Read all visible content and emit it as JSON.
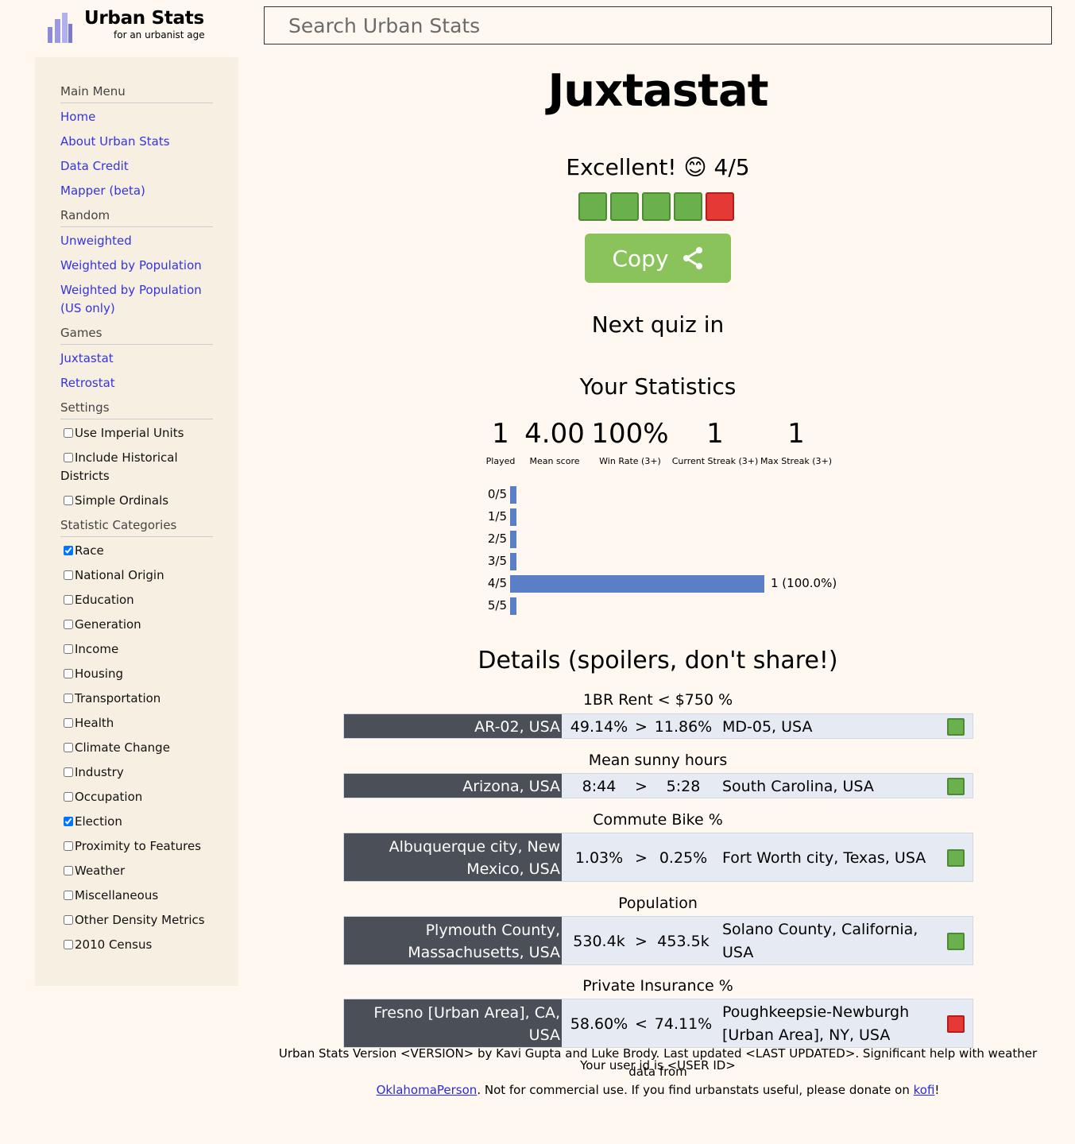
{
  "brand": {
    "title": "Urban Stats",
    "subtitle": "for an urbanist age"
  },
  "search": {
    "placeholder": "Search Urban Stats"
  },
  "sidebar": {
    "main_menu": {
      "heading": "Main Menu",
      "items": [
        "Home",
        "About Urban Stats",
        "Data Credit",
        "Mapper (beta)"
      ]
    },
    "random": {
      "heading": "Random",
      "items": [
        "Unweighted",
        "Weighted by Population",
        "Weighted by Population (US only)"
      ]
    },
    "games": {
      "heading": "Games",
      "items": [
        "Juxtastat",
        "Retrostat"
      ]
    },
    "settings": {
      "heading": "Settings",
      "items": [
        {
          "label": "Use Imperial Units",
          "checked": false
        },
        {
          "label": "Include Historical Districts",
          "checked": false
        },
        {
          "label": "Simple Ordinals",
          "checked": false
        }
      ]
    },
    "categories": {
      "heading": "Statistic Categories",
      "items": [
        {
          "label": "Race",
          "checked": true
        },
        {
          "label": "National Origin",
          "checked": false
        },
        {
          "label": "Education",
          "checked": false
        },
        {
          "label": "Generation",
          "checked": false
        },
        {
          "label": "Income",
          "checked": false
        },
        {
          "label": "Housing",
          "checked": false
        },
        {
          "label": "Transportation",
          "checked": false
        },
        {
          "label": "Health",
          "checked": false
        },
        {
          "label": "Climate Change",
          "checked": false
        },
        {
          "label": "Industry",
          "checked": false
        },
        {
          "label": "Occupation",
          "checked": false
        },
        {
          "label": "Election",
          "checked": true
        },
        {
          "label": "Proximity to Features",
          "checked": false
        },
        {
          "label": "Weather",
          "checked": false
        },
        {
          "label": "Miscellaneous",
          "checked": false
        },
        {
          "label": "Other Density Metrics",
          "checked": false
        },
        {
          "label": "2010 Census",
          "checked": false
        }
      ]
    }
  },
  "main": {
    "title": "Juxtastat",
    "result_text": "Excellent! 😊 4/5",
    "result_squares": [
      "green",
      "green",
      "green",
      "green",
      "red"
    ],
    "copy_label": "Copy",
    "next_quiz": "Next quiz in",
    "stats_title": "Your Statistics",
    "stats": [
      {
        "value": "1",
        "label": "Played"
      },
      {
        "value": "4.00",
        "label": "Mean score"
      },
      {
        "value": "100%",
        "label": "Win Rate (3+)"
      },
      {
        "value": "1",
        "label": "Current Streak (3+)"
      },
      {
        "value": "1",
        "label": "Max Streak (3+)"
      }
    ],
    "distribution": [
      {
        "label": "0/5",
        "fraction": 0,
        "text": ""
      },
      {
        "label": "1/5",
        "fraction": 0,
        "text": ""
      },
      {
        "label": "2/5",
        "fraction": 0,
        "text": ""
      },
      {
        "label": "3/5",
        "fraction": 0,
        "text": ""
      },
      {
        "label": "4/5",
        "fraction": 1.0,
        "text": "1 (100.0%)"
      },
      {
        "label": "5/5",
        "fraction": 0,
        "text": ""
      }
    ],
    "details_title": "Details (spoilers, don't share!)",
    "questions": [
      {
        "stat": "1BR Rent < $750 %",
        "left": "AR-02, USA",
        "v1": "49.14%",
        "op": ">",
        "v2": "11.86%",
        "right": "MD-05, USA",
        "correct": true
      },
      {
        "stat": "Mean sunny hours",
        "left": "Arizona, USA",
        "v1": "8:44",
        "op": ">",
        "v2": "5:28",
        "right": "South Carolina, USA",
        "correct": true
      },
      {
        "stat": "Commute Bike %",
        "left": "Albuquerque city, New Mexico, USA",
        "v1": "1.03%",
        "op": ">",
        "v2": "0.25%",
        "right": "Fort Worth city, Texas, USA",
        "correct": true
      },
      {
        "stat": "Population",
        "left": "Plymouth County, Massachusetts, USA",
        "v1": "530.4k",
        "op": ">",
        "v2": "453.5k",
        "right": "Solano County, California, USA",
        "correct": true
      },
      {
        "stat": "Private Insurance %",
        "left": "Fresno [Urban Area], CA, USA",
        "v1": "58.60%",
        "op": "<",
        "v2": "74.11%",
        "right": "Poughkeepsie-Newburgh [Urban Area], NY, USA",
        "correct": false
      }
    ],
    "user_id": "Your user id is <USER ID>"
  },
  "footer": {
    "line1": "Urban Stats Version <VERSION> by Kavi Gupta and Luke Brody. Last updated <LAST UPDATED>. Significant help with weather data from",
    "link1": "OklahomaPerson",
    "mid": ". Not for commercial use. If you find urbanstats useful, please donate on",
    "link2": "kofi",
    "end": "!"
  },
  "colors": {
    "accent_link": "#3434e0",
    "bar": "#5b7fc7",
    "copy_button": "#8ac35b",
    "correct": "#6ab04c",
    "wrong": "#e53935",
    "left_cell": "#4a4f58",
    "row_bg": "#e6eaf3"
  }
}
